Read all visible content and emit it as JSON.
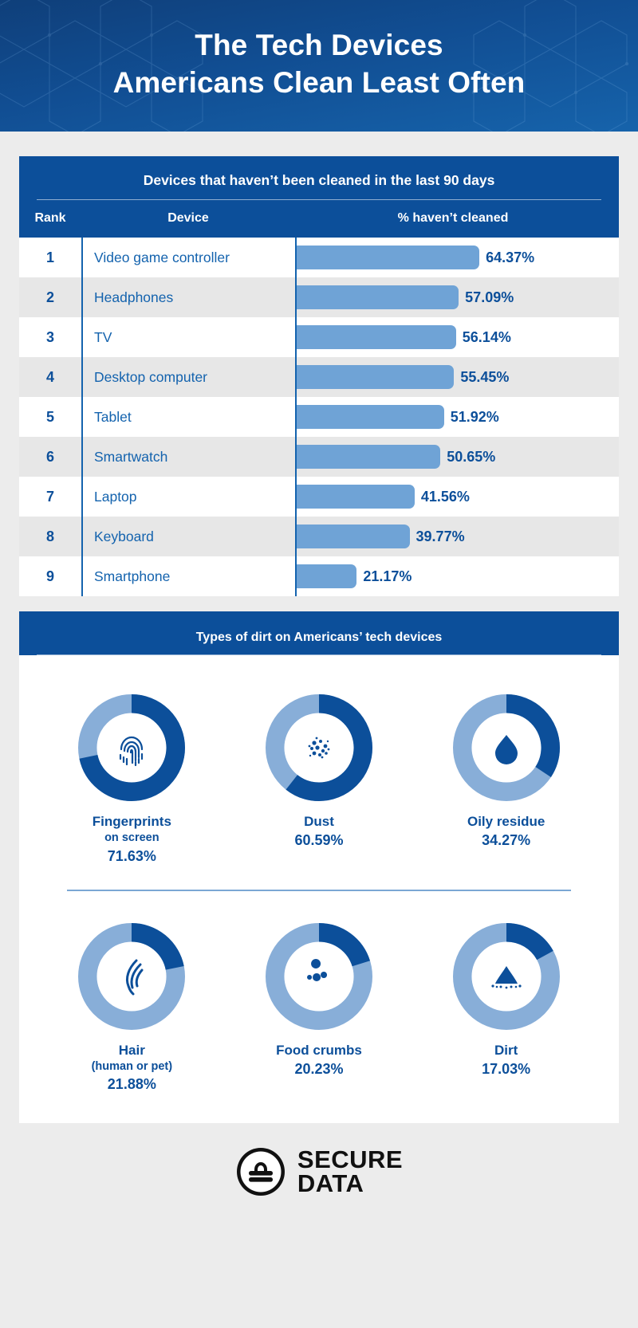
{
  "header": {
    "title_line1": "The Tech Devices",
    "title_line2": "Americans Clean Least Often"
  },
  "table": {
    "title": "Devices that haven’t been cleaned in the last 90 days",
    "columns": {
      "rank": "Rank",
      "device": "Device",
      "percent": "% haven’t cleaned"
    }
  },
  "donuts": {
    "title": "Types of dirt on Americans’ tech devices"
  },
  "footer": {
    "logo_line1": "SECURE",
    "logo_line2": "DATA",
    "logo_icon": "secure-data-lock-icon"
  },
  "colors": {
    "dark_blue": "#0c4f9a",
    "mid_blue": "#1463ae",
    "light_blue": "#6fa3d6",
    "donut_light": "#88aed8",
    "page_bg": "#ececec",
    "row_alt": "#e7e7e7"
  },
  "chart_data": [
    {
      "type": "bar",
      "title": "Devices that haven’t been cleaned in the last 90 days",
      "xlabel": "% haven’t cleaned",
      "ylabel": "Device",
      "orientation": "horizontal",
      "xlim": [
        0,
        70
      ],
      "grid": false,
      "legend": null,
      "categories": [
        "Video game controller",
        "Headphones",
        "TV",
        "Desktop computer",
        "Tablet",
        "Smartwatch",
        "Laptop",
        "Keyboard",
        "Smartphone"
      ],
      "values": [
        64.37,
        57.09,
        56.14,
        55.45,
        51.92,
        50.65,
        41.56,
        39.77,
        21.17
      ],
      "rows": [
        {
          "rank": "1",
          "device": "Video game controller",
          "value": 64.37,
          "label": "64.37%"
        },
        {
          "rank": "2",
          "device": "Headphones",
          "value": 57.09,
          "label": "57.09%"
        },
        {
          "rank": "3",
          "device": "TV",
          "value": 56.14,
          "label": "56.14%"
        },
        {
          "rank": "4",
          "device": "Desktop computer",
          "value": 55.45,
          "label": "55.45%"
        },
        {
          "rank": "5",
          "device": "Tablet",
          "value": 51.92,
          "label": "51.92%"
        },
        {
          "rank": "6",
          "device": "Smartwatch",
          "value": 50.65,
          "label": "50.65%"
        },
        {
          "rank": "7",
          "device": "Laptop",
          "value": 41.56,
          "label": "41.56%"
        },
        {
          "rank": "8",
          "device": "Keyboard",
          "value": 39.77,
          "label": "39.77%"
        },
        {
          "rank": "9",
          "device": "Smartphone",
          "value": 21.17,
          "label": "21.17%"
        }
      ]
    },
    {
      "type": "pie",
      "title": "Types of dirt on Americans’ tech devices",
      "subtype": "donut",
      "legend": "below-each",
      "items": [
        {
          "label_line1": "Fingerprints",
          "label_line2": "on screen",
          "value": 71.63,
          "label": "71.63%",
          "icon": "fingerprint-icon"
        },
        {
          "label_line1": "Dust",
          "label_line2": "",
          "value": 60.59,
          "label": "60.59%",
          "icon": "dust-particles-icon"
        },
        {
          "label_line1": "Oily residue",
          "label_line2": "",
          "value": 34.27,
          "label": "34.27%",
          "icon": "oil-droplet-icon"
        },
        {
          "label_line1": "Hair",
          "label_line2": "(human or pet)",
          "value": 21.88,
          "label": "21.88%",
          "icon": "hair-strand-icon"
        },
        {
          "label_line1": "Food crumbs",
          "label_line2": "",
          "value": 20.23,
          "label": "20.23%",
          "icon": "food-crumbs-icon"
        },
        {
          "label_line1": "Dirt",
          "label_line2": "",
          "value": 17.03,
          "label": "17.03%",
          "icon": "dirt-pile-icon"
        }
      ]
    }
  ]
}
